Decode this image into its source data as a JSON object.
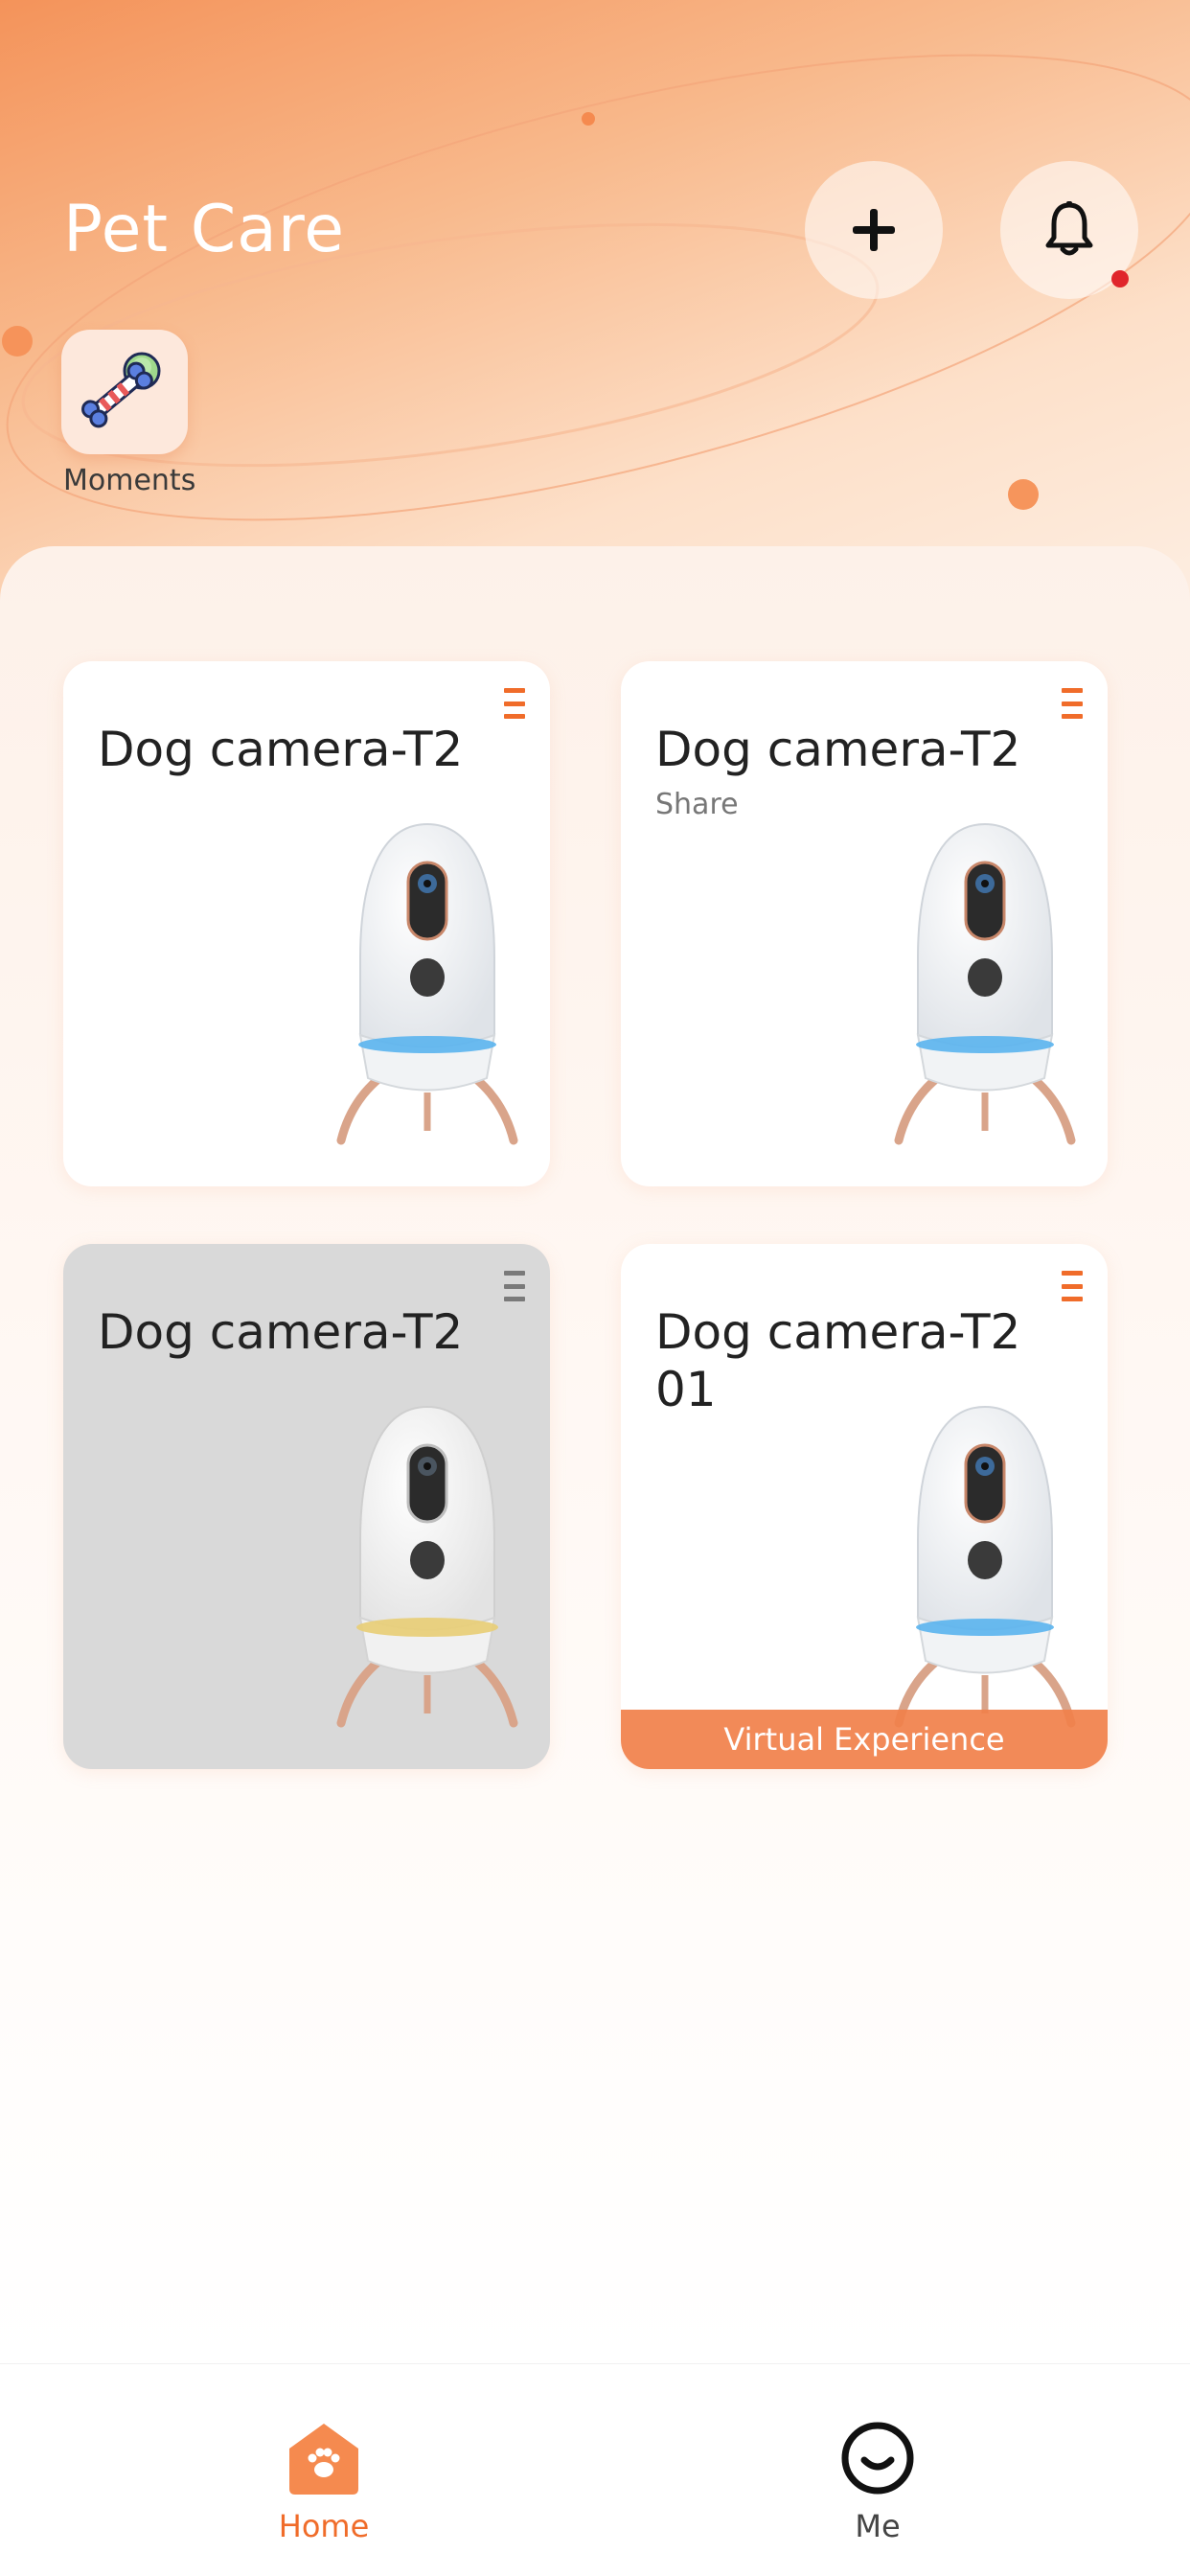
{
  "header": {
    "title": "Pet Care",
    "add_icon": "plus-icon",
    "notification_icon": "bell-icon",
    "has_unread_notification": true
  },
  "shortcuts": [
    {
      "label": "Moments",
      "icon": "bone-and-ball-icon"
    }
  ],
  "devices": [
    {
      "name": "Dog camera-T2",
      "subtitle": "",
      "status": "online",
      "banner": ""
    },
    {
      "name": "Dog camera-T2",
      "subtitle": "Share",
      "status": "online",
      "banner": ""
    },
    {
      "name": "Dog camera-T2",
      "subtitle": "",
      "status": "offline",
      "banner": ""
    },
    {
      "name": "Dog camera-T2 01",
      "subtitle": "",
      "status": "online",
      "banner": "Virtual Experience"
    }
  ],
  "tabbar": {
    "items": [
      {
        "label": "Home",
        "icon": "home-paw-icon",
        "active": true
      },
      {
        "label": "Me",
        "icon": "smiley-face-icon",
        "active": false
      }
    ]
  },
  "colors": {
    "accent": "#f06c2a",
    "header_gradient_start": "#f4935a",
    "header_gradient_end": "#fdeee2",
    "offline_card": "#d9d9d9",
    "online_ring": "#5ab4ee",
    "offline_ring": "#e8cf7a",
    "notification_dot": "#e0252b"
  }
}
